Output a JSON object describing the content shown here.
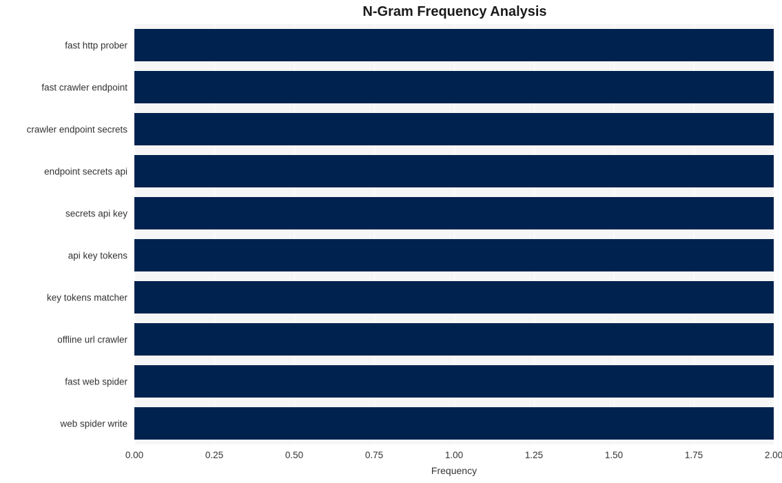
{
  "chart_data": {
    "type": "bar",
    "orientation": "horizontal",
    "title": "N-Gram Frequency Analysis",
    "xlabel": "Frequency",
    "ylabel": "",
    "categories": [
      "fast http prober",
      "fast crawler endpoint",
      "crawler endpoint secrets",
      "endpoint secrets api",
      "secrets api key",
      "api key tokens",
      "key tokens matcher",
      "offline url crawler",
      "fast web spider",
      "web spider write"
    ],
    "values": [
      2,
      2,
      2,
      2,
      2,
      2,
      2,
      2,
      2,
      2
    ],
    "xlim": [
      0.0,
      2.0
    ],
    "xticks": [
      0.0,
      0.25,
      0.5,
      0.75,
      1.0,
      1.25,
      1.5,
      1.75,
      2.0
    ],
    "xtick_labels": [
      "0.00",
      "0.25",
      "0.50",
      "0.75",
      "1.00",
      "1.25",
      "1.50",
      "1.75",
      "2.00"
    ],
    "grid": true,
    "grid_axis": "x",
    "legend": null,
    "colors": {
      "bar": "#00224f",
      "plot_background": "#f6f6f6",
      "figure_background": "#ffffff",
      "gridline": "#ffffff",
      "text": "#333333",
      "title_text": "#1a1a1a"
    }
  }
}
